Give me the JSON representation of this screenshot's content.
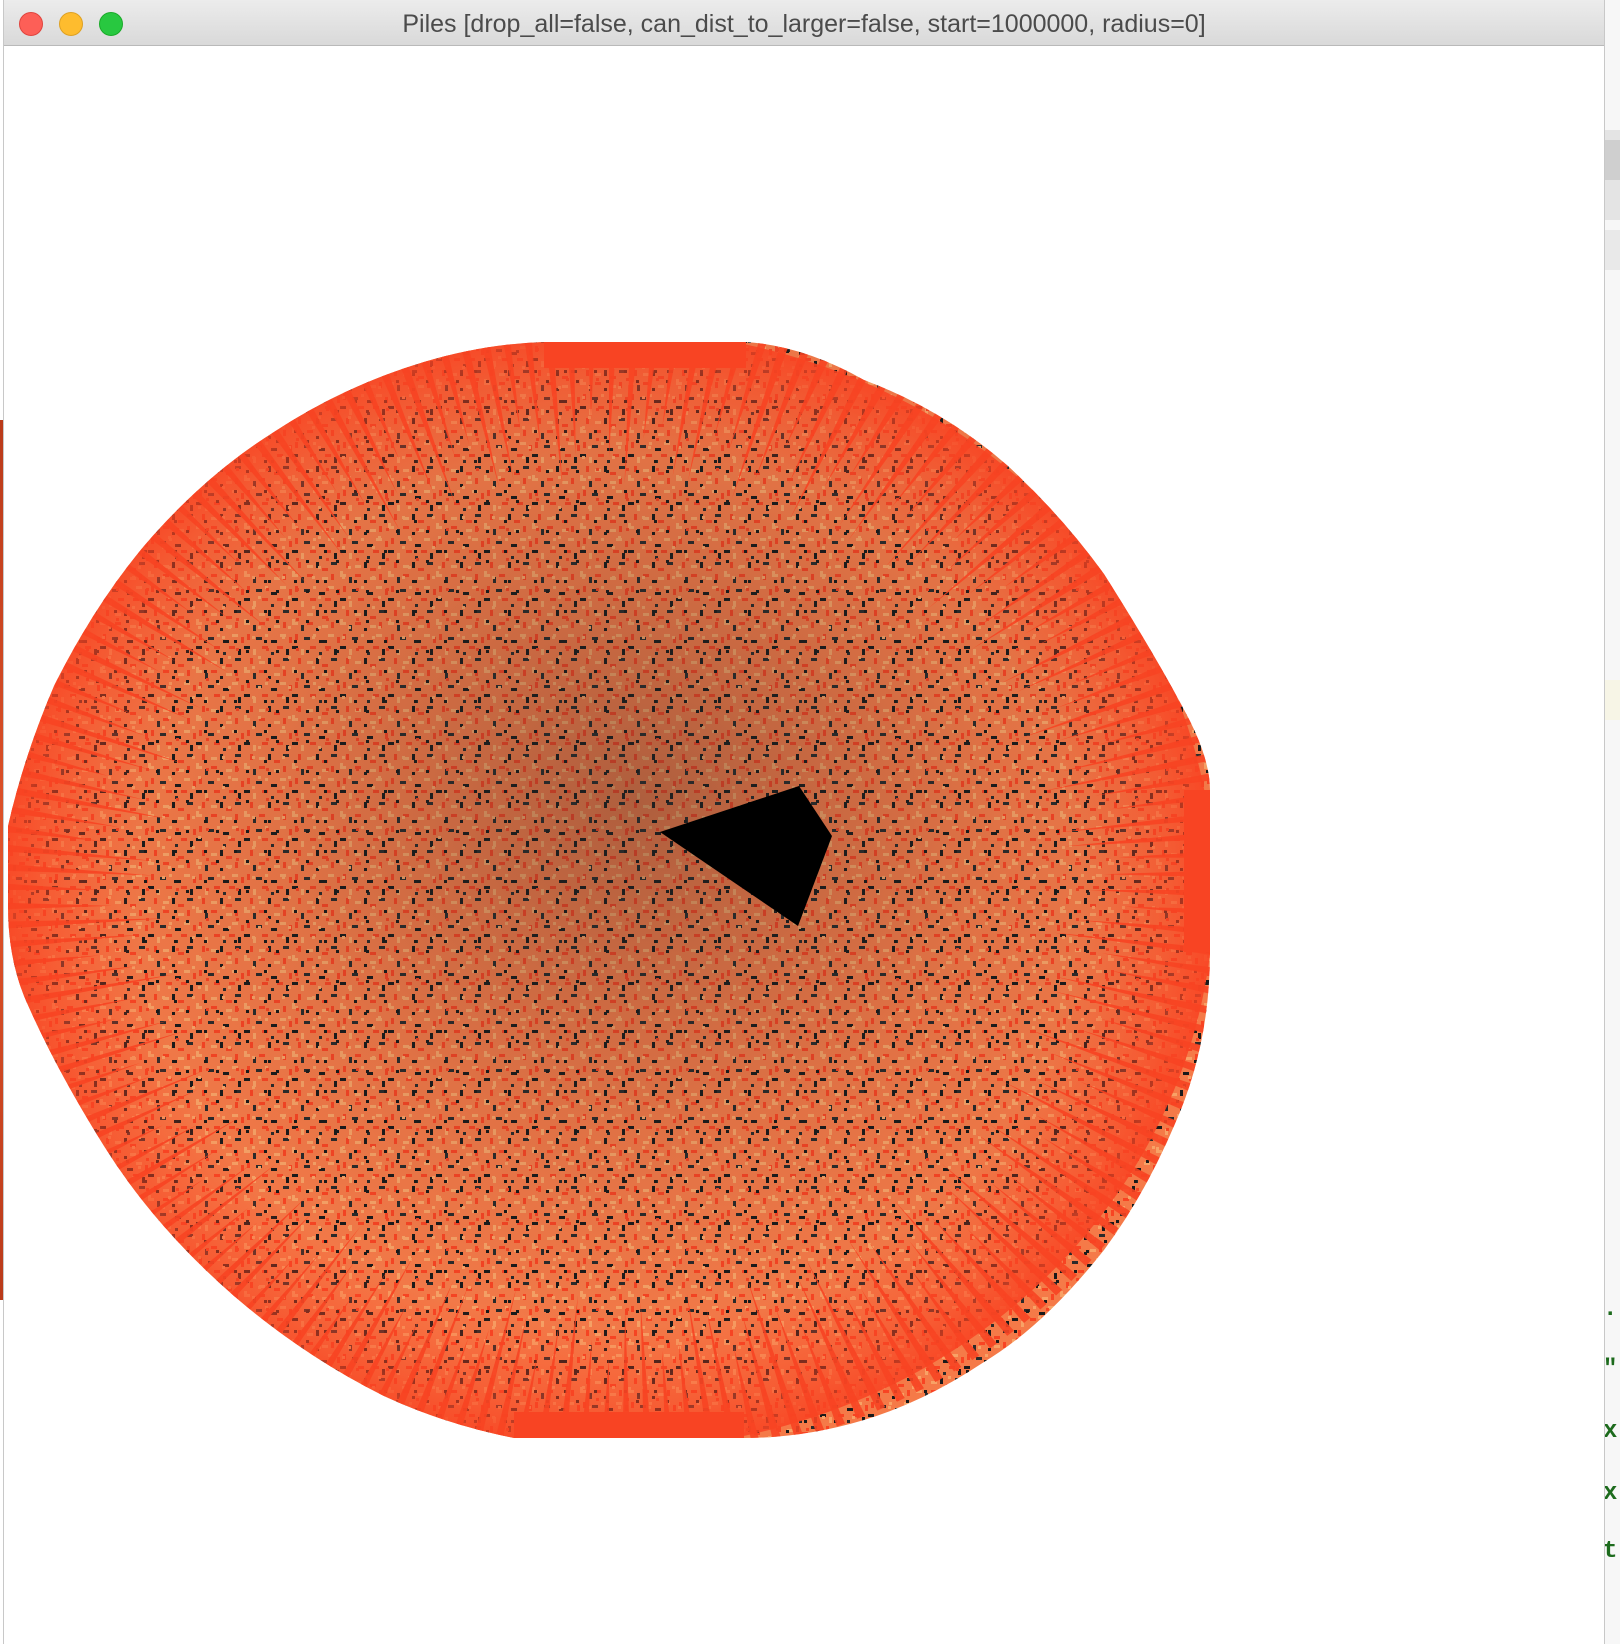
{
  "window": {
    "title": "Piles  [drop_all=false, can_dist_to_larger=false, start=1000000, radius=0]"
  },
  "background_window": {
    "visible_code_fragments": [
      ".'",
      "\"",
      "x'",
      "x'",
      "t'"
    ]
  },
  "palette": {
    "fill_primary": "#f84423",
    "fill_secondary": "#f8a266",
    "fill_dark": "#1a1a1a",
    "center_hole": "#000000",
    "close_button": "#fd5f57",
    "minimize_button": "#febc2e",
    "maximize_button": "#28c840"
  }
}
